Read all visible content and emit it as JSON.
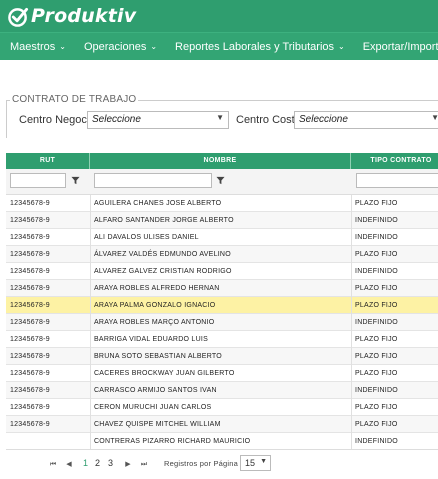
{
  "app": {
    "name": "Produktiv"
  },
  "nav": [
    {
      "label": "Maestros"
    },
    {
      "label": "Operaciones"
    },
    {
      "label": "Reportes Laborales y Tributarios"
    },
    {
      "label": "Exportar/Importar"
    }
  ],
  "filters": {
    "legend": "CONTRATO DE TRABAJO",
    "centro_negocio_label": "Centro Negocio",
    "centro_negocio_value": "Seleccione",
    "centro_costo_label": "Centro Costo",
    "centro_costo_value": "Seleccione"
  },
  "grid": {
    "columns": [
      "RUT",
      "NOMBRE",
      "TIPO CONTRATO"
    ],
    "selected_row": 6,
    "rows": [
      {
        "rut": "12345678-9",
        "nombre": "AGUILERA CHANES JOSE ALBERTO",
        "tipo": "PLAZO FIJO"
      },
      {
        "rut": "12345678-9",
        "nombre": "ALFARO SANTANDER JORGE ALBERTO",
        "tipo": "INDEFINIDO"
      },
      {
        "rut": "12345678-9",
        "nombre": "ALI DAVALOS ULISES DANIEL",
        "tipo": "INDEFINIDO"
      },
      {
        "rut": "12345678-9",
        "nombre": "ÁLVAREZ VALDÉS EDMUNDO AVELINO",
        "tipo": "PLAZO FIJO"
      },
      {
        "rut": "12345678-9",
        "nombre": "ALVAREZ GALVEZ CRISTIAN RODRIGO",
        "tipo": "INDEFINIDO"
      },
      {
        "rut": "12345678-9",
        "nombre": "ARAYA ROBLES ALFREDO HERNAN",
        "tipo": "PLAZO FIJO"
      },
      {
        "rut": "12345678-9",
        "nombre": "ARAYA PALMA GONZALO IGNACIO",
        "tipo": "PLAZO FIJO"
      },
      {
        "rut": "12345678-9",
        "nombre": "ARAYA ROBLES MARÇO ANTONIO",
        "tipo": "INDEFINIDO"
      },
      {
        "rut": "12345678-9",
        "nombre": "BARRIGA VIDAL EDUARDO LUIS",
        "tipo": "PLAZO FIJO"
      },
      {
        "rut": "12345678-9",
        "nombre": "BRUNA SOTO SEBASTIAN ALBERTO",
        "tipo": "PLAZO FIJO"
      },
      {
        "rut": "12345678-9",
        "nombre": "CACERES BROCKWAY JUAN GILBERTO",
        "tipo": "PLAZO FIJO"
      },
      {
        "rut": "12345678-9",
        "nombre": "CARRASCO ARMIJO SANTOS IVAN",
        "tipo": "INDEFINIDO"
      },
      {
        "rut": "12345678-9",
        "nombre": "CERON MURUCHI JUAN CARLOS",
        "tipo": "PLAZO FIJO"
      },
      {
        "rut": "12345678-9",
        "nombre": "CHAVEZ QUISPE MITCHEL WILLIAM",
        "tipo": "PLAZO FIJO"
      },
      {
        "rut": "",
        "nombre": "CONTRERAS PIZARRO RICHARD MAURICIO",
        "tipo": "INDEFINIDO"
      }
    ]
  },
  "pager": {
    "pages": [
      "1",
      "2",
      "3"
    ],
    "current": "1",
    "records_label": "Registros por Página",
    "page_size": "15"
  },
  "colors": {
    "brand": "#2f9e6f",
    "nav": "#33a574",
    "selected_row": "#fdf2a4"
  },
  "icons": {
    "logo": "check-circle-icon",
    "filter": "funnel-icon",
    "first": "first-page-icon",
    "prev": "prev-page-icon",
    "next": "next-page-icon",
    "last": "last-page-icon"
  }
}
